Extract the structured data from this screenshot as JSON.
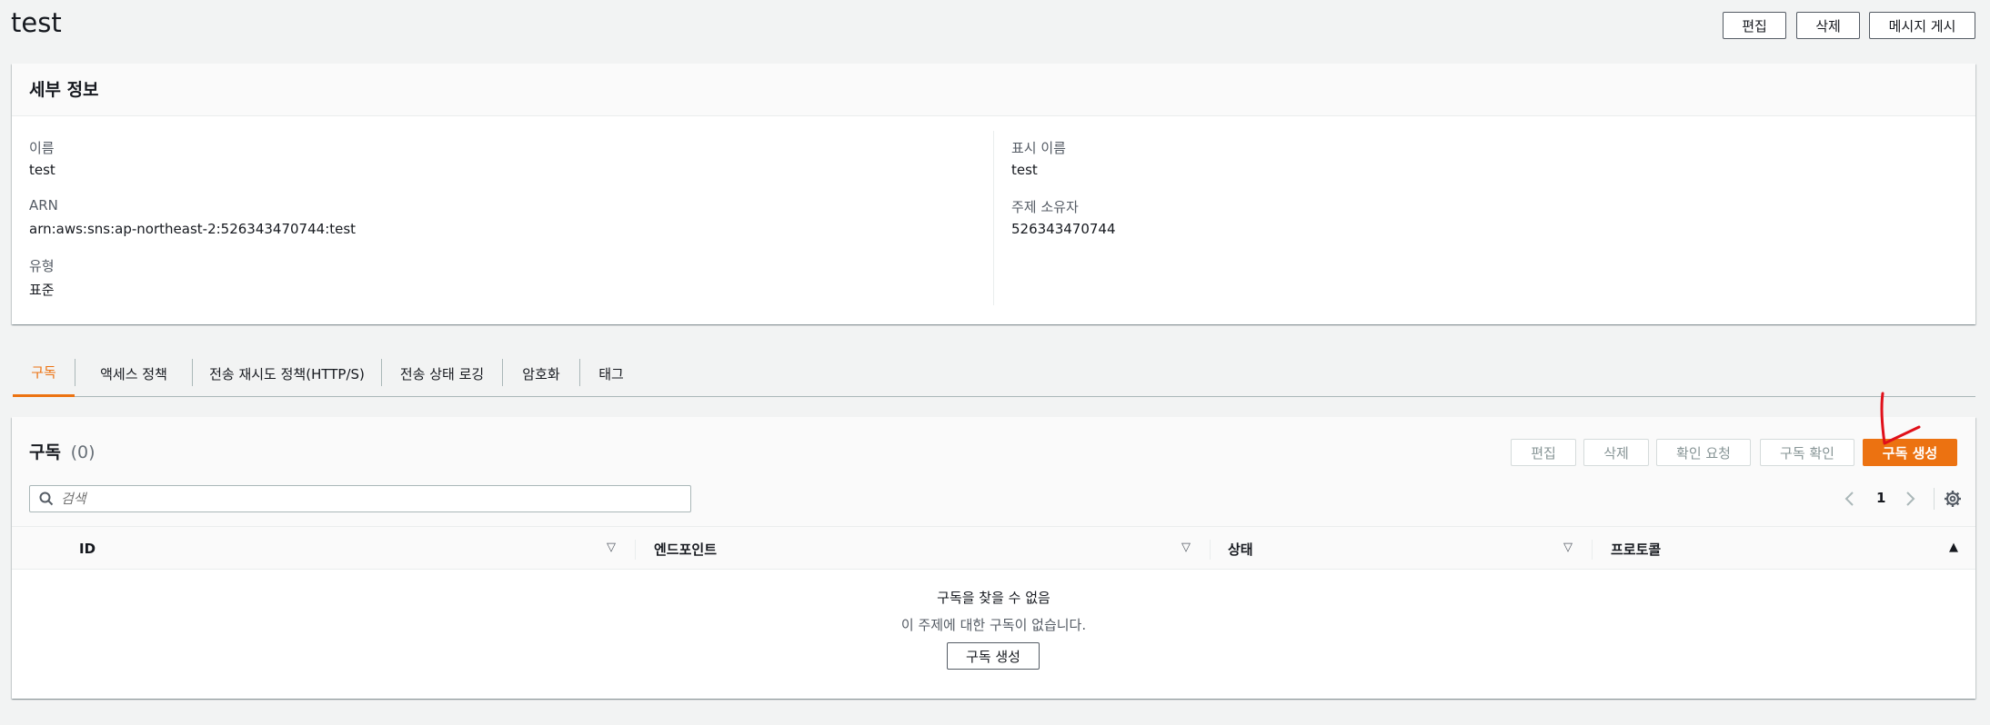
{
  "header": {
    "title": "test",
    "edit_label": "편집",
    "delete_label": "삭제",
    "publish_label": "메시지 게시"
  },
  "details": {
    "section_title": "세부 정보",
    "name_label": "이름",
    "name_value": "test",
    "arn_label": "ARN",
    "arn_value": "arn:aws:sns:ap-northeast-2:526343470744:test",
    "type_label": "유형",
    "type_value": "표준",
    "display_name_label": "표시 이름",
    "display_name_value": "test",
    "owner_label": "주제 소유자",
    "owner_value": "526343470744"
  },
  "tabs": [
    {
      "label": "구독",
      "active": true
    },
    {
      "label": "액세스 정책"
    },
    {
      "label": "전송 재시도 정책(HTTP/S)"
    },
    {
      "label": "전송 상태 로깅"
    },
    {
      "label": "암호화"
    },
    {
      "label": "태그"
    }
  ],
  "subscriptions": {
    "title": "구독",
    "count": "(0)",
    "edit_label": "편집",
    "delete_label": "삭제",
    "request_confirm_label": "확인 요청",
    "confirm_label": "구독 확인",
    "create_label": "구독 생성",
    "search_placeholder": "검색",
    "page_number": "1",
    "columns": [
      "ID",
      "엔드포인트",
      "상태",
      "프로토콜"
    ],
    "empty_title": "구독을 찾을 수 없음",
    "empty_desc": "이 주제에 대한 구독이 없습니다.",
    "empty_create_label": "구독 생성"
  },
  "colors": {
    "accent": "#ec7211",
    "annotation": "#e0101a"
  },
  "icons": {
    "search": "search-icon",
    "prev": "chevron-left-icon",
    "next": "chevron-right-icon",
    "settings": "gear-icon",
    "sort": "caret-down-icon",
    "sort_active": "caret-up-icon"
  }
}
